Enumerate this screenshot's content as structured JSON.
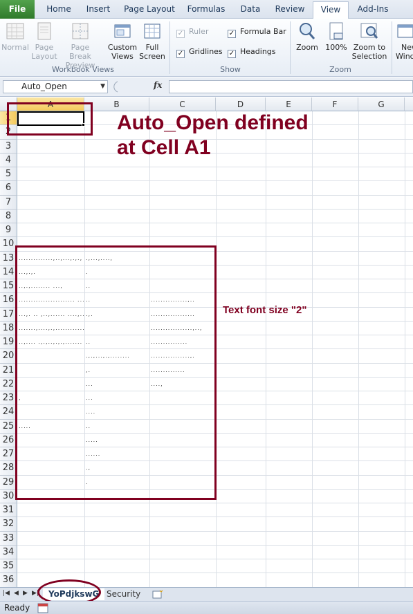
{
  "ribbon": {
    "tabs": [
      "File",
      "Home",
      "Insert",
      "Page Layout",
      "Formulas",
      "Data",
      "Review",
      "View",
      "Add-Ins"
    ],
    "active_tab": "View",
    "workbook_views": {
      "label": "Workbook Views",
      "normal": "Normal",
      "page_layout": [
        "Page",
        "Layout"
      ],
      "page_break": [
        "Page Break",
        "Preview"
      ],
      "custom": [
        "Custom",
        "Views"
      ],
      "full": [
        "Full",
        "Screen"
      ]
    },
    "show": {
      "label": "Show",
      "ruler": "Ruler",
      "formula_bar": "Formula Bar",
      "gridlines": "Gridlines",
      "headings": "Headings"
    },
    "zoom": {
      "label": "Zoom",
      "zoom": "Zoom",
      "pct": "100%",
      "zoom_sel": [
        "Zoom to",
        "Selection"
      ],
      "new_window": [
        "New",
        "Window"
      ]
    }
  },
  "formula_bar": {
    "name_box": "Auto_Open",
    "fx": "fx",
    "content": ""
  },
  "columns": [
    "A",
    "B",
    "C",
    "D",
    "E",
    "F",
    "G"
  ],
  "rows": [
    "1",
    "2",
    "3",
    "4",
    "5",
    "6",
    "7",
    "8",
    "9",
    "10",
    "13",
    "14",
    "15",
    "16",
    "17",
    "18",
    "19",
    "20",
    "21",
    "22",
    "23",
    "24",
    "25",
    "26",
    "27",
    "28",
    "29",
    "30",
    "31",
    "32",
    "33",
    "34",
    "35",
    "36"
  ],
  "cells": {
    "A": [
      "..............,..,...,.,.,",
      "...,.,.",
      "..,.,........ ...,",
      "....................... ...............",
      "...,. .. ,..,...... ....,...........",
      ".......,....,.,...............",
      "..,.... .,.,..,.,.,....... ..,,......",
      "",
      "",
      "",
      ",",
      "",
      "....."
    ],
    "B": [
      ".,...,....,",
      ".",
      "..",
      "..",
      ".,.",
      "",
      "..",
      ".,.,...,.,........",
      ",.",
      "...",
      "...",
      "....",
      ".."
    ],
    "C": [
      "",
      "",
      "",
      "...............,..",
      "..................",
      ".................,..,",
      "...............",
      "................,.",
      "..............",
      "....,",
      "",
      "",
      ""
    ]
  },
  "cells_b_extra": [
    ".....",
    "......",
    ".,",
    "."
  ],
  "annotations": {
    "title_line1": "Auto_Open defined",
    "title_line2": "at Cell A1",
    "font_note": "Text font size \"2\""
  },
  "sheets": [
    "YoPdjkswG",
    "Security"
  ],
  "status": {
    "text": "Ready"
  }
}
